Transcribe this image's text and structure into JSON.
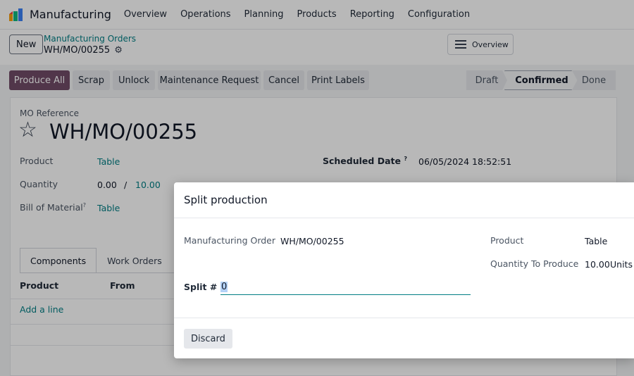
{
  "topnav": {
    "app_title": "Manufacturing",
    "items": [
      "Overview",
      "Operations",
      "Planning",
      "Products",
      "Reporting",
      "Configuration"
    ]
  },
  "control": {
    "new_label": "New",
    "crumb_parent": "Manufacturing Orders",
    "crumb_current": "WH/MO/00255",
    "overview_label": "Overview"
  },
  "actions": {
    "produce_all": "Produce All",
    "scrap": "Scrap",
    "unlock": "Unlock",
    "maintenance": "Maintenance Request",
    "cancel": "Cancel",
    "print_labels": "Print Labels"
  },
  "status": {
    "draft": "Draft",
    "confirmed": "Confirmed",
    "done": "Done",
    "current": "Confirmed"
  },
  "form": {
    "ref_label": "MO Reference",
    "ref_value": "WH/MO/00255",
    "product_label": "Product",
    "product_value": "Table",
    "quantity_label": "Quantity",
    "quantity_produced": "0.00",
    "quantity_sep": "/",
    "quantity_total": "10.00",
    "bom_label": "Bill of Material",
    "bom_value": "Table",
    "scheduled_label": "Scheduled Date",
    "scheduled_value": "06/05/2024 18:52:51",
    "help_mark": "?"
  },
  "tabs": {
    "components": "Components",
    "work_orders": "Work Orders"
  },
  "table": {
    "col_product": "Product",
    "col_from": "From",
    "add_line": "Add a line"
  },
  "modal": {
    "title": "Split production",
    "mo_label": "Manufacturing Order",
    "mo_value": "WH/MO/00255",
    "product_label": "Product",
    "product_value": "Table",
    "qty_label": "Quantity To Produce",
    "qty_value": "10.00",
    "qty_unit": "Units",
    "split_label": "Split #",
    "split_value": "0",
    "discard": "Discard"
  },
  "colors": {
    "brand": "#714b67",
    "link": "#017e84"
  }
}
